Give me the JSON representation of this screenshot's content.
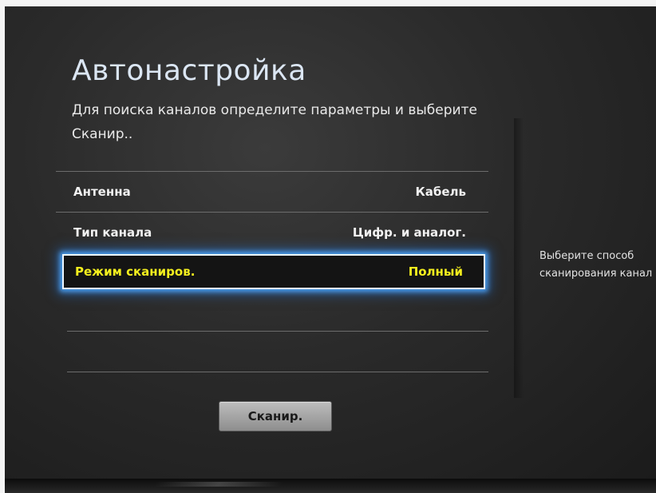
{
  "screen": {
    "title": "Автонастройка",
    "subtitle": "Для поиска каналов определите параметры и выберите Сканир.."
  },
  "settings": [
    {
      "label": "Антенна",
      "value": "Кабель",
      "selected": false
    },
    {
      "label": "Тип канала",
      "value": "Цифр. и аналог.",
      "selected": false
    },
    {
      "label": "Режим сканиров.",
      "value": "Полный",
      "selected": true
    }
  ],
  "scan_button": {
    "label": "Сканир."
  },
  "help": {
    "line1": "Выберите способ",
    "line2": "сканирования канал"
  },
  "colors": {
    "selected_text": "#f4ef1e",
    "focus_glow": "#50aaff",
    "title": "#dbe6f3"
  }
}
